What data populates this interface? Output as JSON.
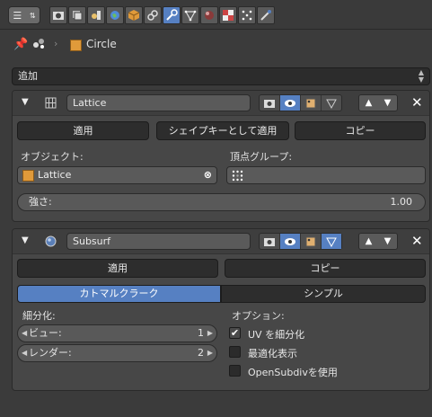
{
  "properties_header": {
    "context": {
      "object_name": "Circle"
    }
  },
  "add_modifier": {
    "label": "追加"
  },
  "lattice_modifier": {
    "name": "Lattice",
    "apply_label": "適用",
    "apply_as_shape_label": "シェイプキーとして適用",
    "copy_label": "コピー",
    "object_label": "オブジェクト:",
    "object_value": "Lattice",
    "vertex_group_label": "頂点グループ:",
    "vertex_group_value": "",
    "strength_label": "強さ:",
    "strength_value": "1.00"
  },
  "subsurf_modifier": {
    "name": "Subsurf",
    "apply_label": "適用",
    "copy_label": "コピー",
    "algorithm_options": [
      "カトマルクラーク",
      "シンプル"
    ],
    "algorithm_selected": "カトマルクラーク",
    "subdivisions_label": "細分化:",
    "view_label": "ビュー:",
    "view_value": "1",
    "render_label": "レンダー:",
    "render_value": "2",
    "options_label": "オプション:",
    "options": [
      {
        "label": "UV を細分化",
        "checked": true
      },
      {
        "label": "最適化表示",
        "checked": false
      },
      {
        "label": "OpenSubdivを使用",
        "checked": false
      }
    ]
  },
  "colors": {
    "accent": "#5680c2",
    "background": "#3b3b3b",
    "panel": "#474747"
  }
}
